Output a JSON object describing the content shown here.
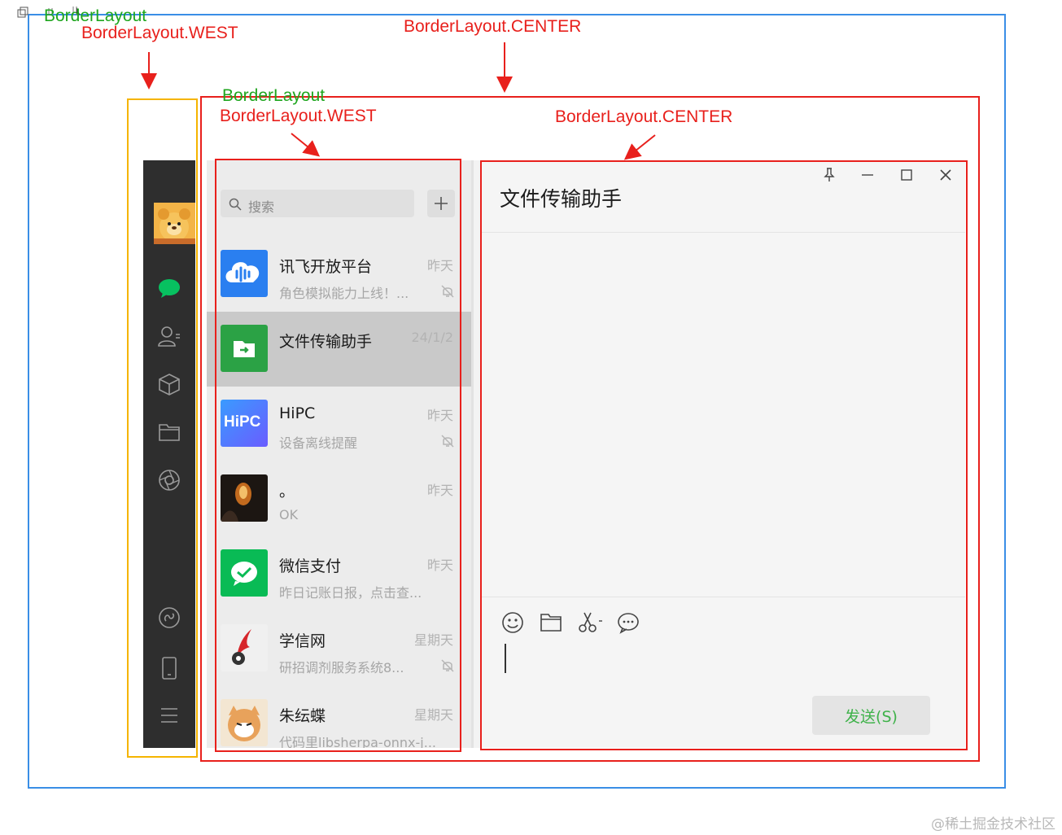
{
  "annotations": {
    "outer_layout": "BorderLayout",
    "outer_west": "BorderLayout.WEST",
    "outer_center": "BorderLayout.CENTER",
    "inner_layout": "BorderLayout",
    "inner_west": "BorderLayout.WEST",
    "inner_center": "BorderLayout.CENTER"
  },
  "search": {
    "placeholder": "搜索"
  },
  "conversations": [
    {
      "name": "讯飞开放平台",
      "time": "昨天",
      "preview": "角色模拟能力上线！...",
      "muted": true,
      "selected": false
    },
    {
      "name": "文件传输助手",
      "time": "24/1/2",
      "preview": "",
      "muted": false,
      "selected": true
    },
    {
      "name": "HiPC",
      "time": "昨天",
      "preview": "设备离线提醒",
      "muted": true,
      "selected": false
    },
    {
      "name": "。",
      "time": "昨天",
      "preview": "OK",
      "muted": false,
      "selected": false
    },
    {
      "name": "微信支付",
      "time": "昨天",
      "preview": "昨日记账日报，点击查...",
      "muted": false,
      "selected": false
    },
    {
      "name": "学信网",
      "time": "星期天",
      "preview": "研招调剂服务系统8...",
      "muted": true,
      "selected": false
    },
    {
      "name": "朱纭蝶",
      "time": "星期天",
      "preview": "代码里libsherpa-onnx-j...",
      "muted": false,
      "selected": false
    }
  ],
  "hipc_logo_text": "HiPC",
  "chat": {
    "title": "文件传输助手",
    "send_label": "发送(S)"
  },
  "watermark": "@稀土掘金技术社区",
  "colors": {
    "red_box": "#e8201c",
    "blue_box": "#3a8ee6",
    "yellow_box": "#f5b400",
    "green_text": "#1fa61f",
    "wechat_green": "#07c160"
  },
  "icons": {
    "sidebar": [
      "avatar",
      "chat-icon",
      "contacts-icon",
      "box-icon",
      "folder-icon",
      "moments-icon",
      "miniprogram-icon",
      "phone-icon",
      "menu-icon"
    ],
    "window": [
      "pin-icon",
      "minimize-icon",
      "maximize-icon",
      "close-icon"
    ],
    "toolbar": [
      "emoji-icon",
      "folder-icon",
      "scissors-icon",
      "chat-bubble-icon"
    ]
  }
}
